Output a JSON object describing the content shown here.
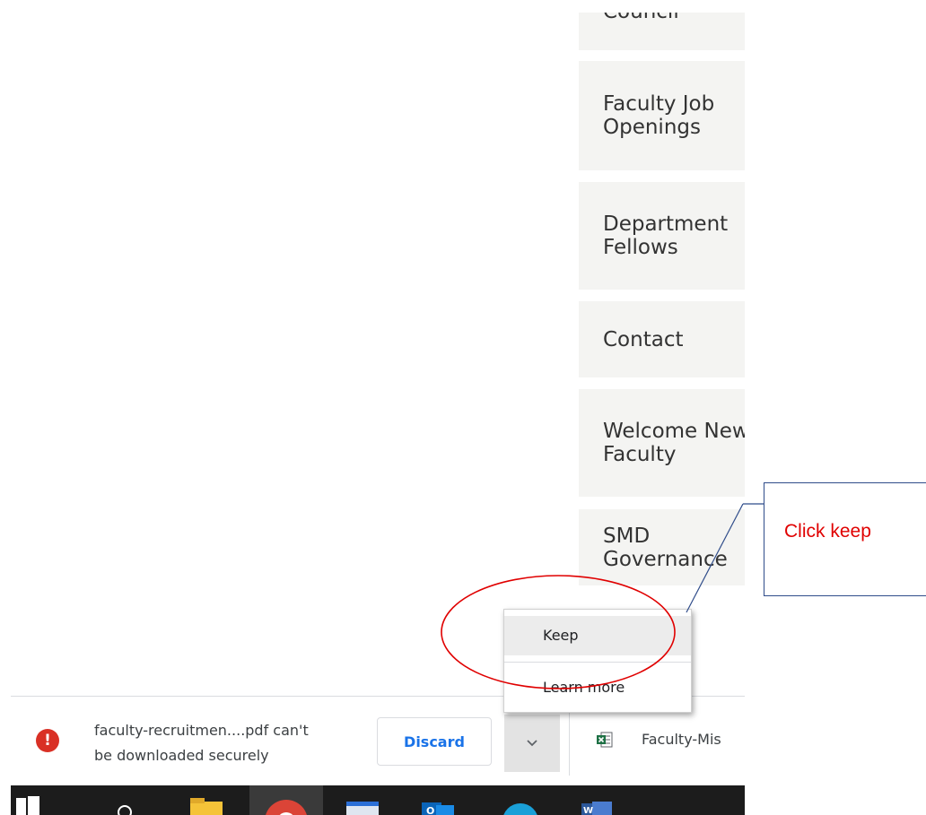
{
  "sidebar": {
    "items": [
      {
        "label": "Council"
      },
      {
        "label": "Faculty Job\nOpenings"
      },
      {
        "label": "Department\nFellows"
      },
      {
        "label": "Contact"
      },
      {
        "label": "Welcome New\nFaculty"
      },
      {
        "label": "SMD Governance"
      }
    ]
  },
  "download_menu": {
    "keep_label": "Keep",
    "learn_more_label": "Learn more"
  },
  "download_bar": {
    "item1": {
      "line1": "faculty-recruitmen....pdf can't",
      "line2": "be downloaded securely",
      "discard_label": "Discard",
      "warning_icon": "error-icon"
    },
    "item2": {
      "filename": "Faculty-Mis",
      "file_icon": "excel-icon"
    }
  },
  "annotation": {
    "text": "Click keep",
    "color": "#e00000"
  },
  "colors": {
    "warning": "#d93025",
    "link_blue": "#1a73e8",
    "nav_bg": "#f4f4f2",
    "taskbar": "#1c1c1c"
  }
}
